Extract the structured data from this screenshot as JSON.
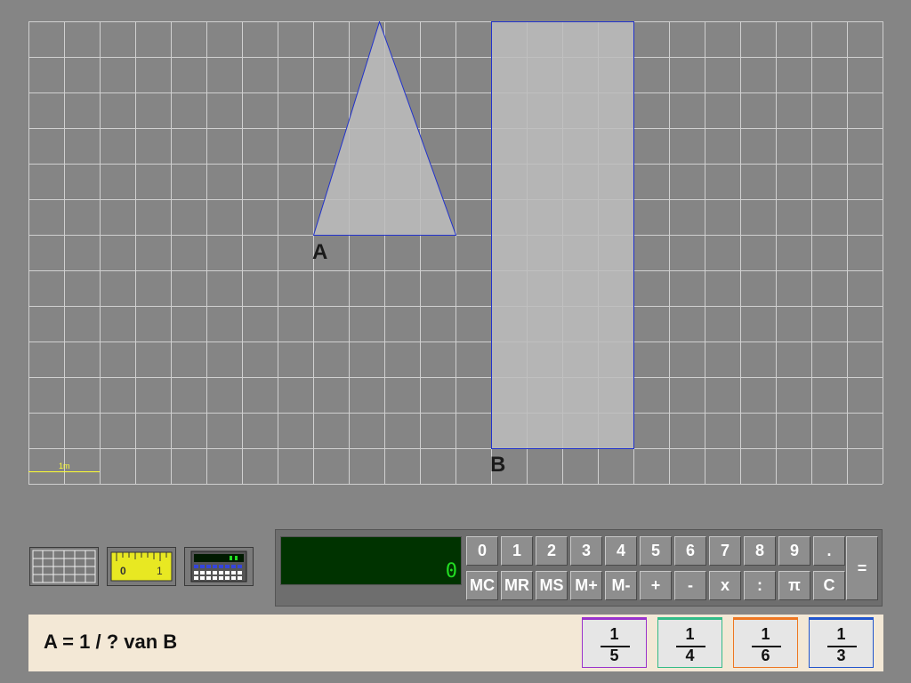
{
  "shapes": {
    "a_label": "A",
    "b_label": "B",
    "scale_label": "1m"
  },
  "toolbar": {
    "grid_tool": "grid-icon",
    "ruler_tool": "ruler-icon",
    "ruler_marks": [
      "0",
      "1"
    ],
    "calculator_tool": "calculator-icon"
  },
  "calculator": {
    "display": "0",
    "row1": [
      "0",
      "1",
      "2",
      "3",
      "4",
      "5",
      "6",
      "7",
      "8",
      "9",
      "."
    ],
    "row2": [
      "MC",
      "MR",
      "MS",
      "M+",
      "M-",
      "+",
      "-",
      "x",
      ":",
      "π",
      "C"
    ],
    "equals": "="
  },
  "question": {
    "text": "A = 1 / ? van B"
  },
  "answers": [
    {
      "numerator": "1",
      "denominator": "5",
      "color": "#9933cc"
    },
    {
      "numerator": "1",
      "denominator": "4",
      "color": "#33bb88"
    },
    {
      "numerator": "1",
      "denominator": "6",
      "color": "#ee7722"
    },
    {
      "numerator": "1",
      "denominator": "3",
      "color": "#2255cc"
    }
  ],
  "colors": {
    "background": "#858585",
    "grid_line": "#d0d0d0",
    "shape_fill": "#bdbdbd",
    "shape_outline": "#2233cc",
    "scale": "#ffff33",
    "calc_display": "#003300",
    "calc_digit": "#22dd22"
  }
}
